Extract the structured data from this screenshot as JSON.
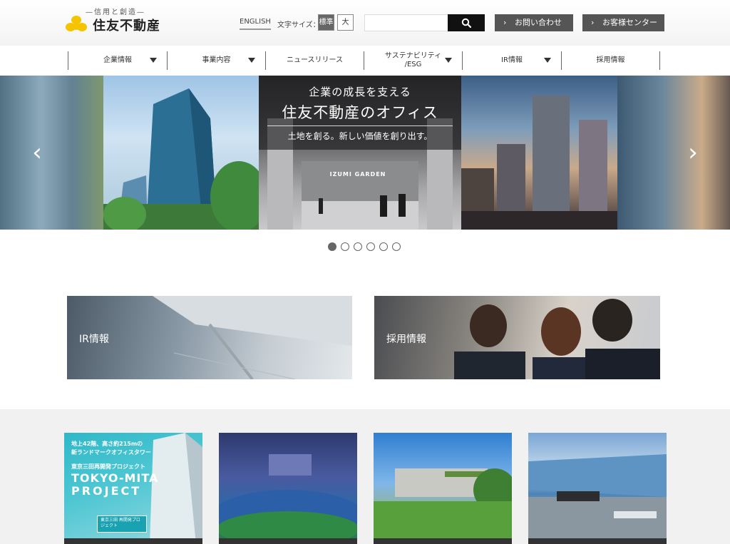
{
  "header": {
    "logo_tagline": "—信用と創造—",
    "logo_name": "住友不動産",
    "english_label": "ENGLISH",
    "font_size_label": "文字サイズ：",
    "font_size_standard": "標準",
    "font_size_large": "大",
    "search_placeholder": "",
    "contact_button": "お問い合わせ",
    "customer_center_button": "お客様センター",
    "chevron_icon": "chevron-right-icon",
    "search_icon": "search-icon"
  },
  "nav": {
    "items": [
      {
        "label": "企業情報",
        "has_dropdown": true
      },
      {
        "label": "事業内容",
        "has_dropdown": true
      },
      {
        "label": "ニュースリリース",
        "has_dropdown": false
      },
      {
        "label": "サステナビリティ/ESG",
        "line1": "サステナビリティ",
        "line2": "/ESG",
        "has_dropdown": true
      },
      {
        "label": "IR情報",
        "has_dropdown": true
      },
      {
        "label": "採用情報",
        "has_dropdown": false
      }
    ]
  },
  "hero": {
    "caption_sub": "企業の成長を支える",
    "caption_main": "住友不動産のオフィス",
    "caption_tag": "土地を創る。新しい価値を創り出す。",
    "lobby_sign": "IZUMI GARDEN",
    "prev_arrow": "‹",
    "next_arrow": "›",
    "dots_count": 6,
    "active_dot": 1
  },
  "banners": {
    "ir_label": "IR情報",
    "recruit_label": "採用情報"
  },
  "projects": {
    "card1": {
      "line1": "地上42階、高さ約215mの",
      "line2": "新ランドマークオフィスタワー",
      "line3": "東京三田再開発プロジェクト",
      "line4": "TOKYO-MITA",
      "line5": "PROJECT",
      "tag": "東京三田 再開発プロジェクト"
    }
  },
  "colors": {
    "logo_yellow": "#f5c400",
    "header_button_bg": "#555555",
    "search_button_bg": "#111111",
    "active_font_button": "#666666",
    "project_section_bg": "#f1f1f1"
  }
}
